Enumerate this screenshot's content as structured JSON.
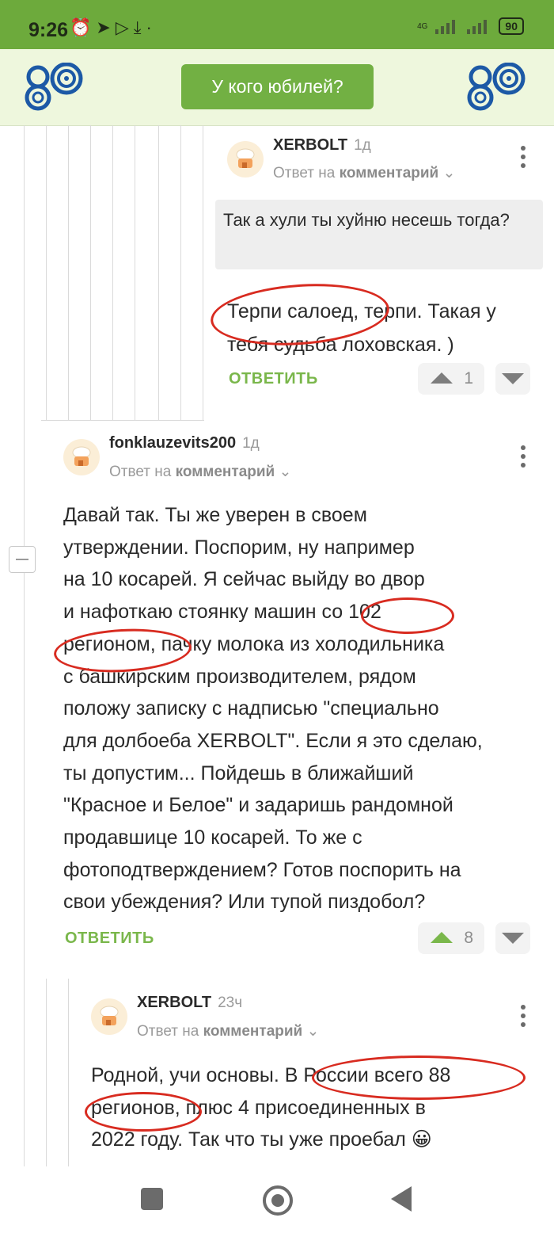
{
  "status_bar": {
    "time": "9:26",
    "battery": "90",
    "network": "4G"
  },
  "header": {
    "anniversary_button": "У кого юбилей?"
  },
  "comments": [
    {
      "username": "XERBOLT",
      "time": "1д",
      "reply_prefix": "Ответ на",
      "reply_target": "комментарий",
      "quote": "Так а хули ты хуйню несешь тогда?",
      "lines": [
        "Терпи салоед, терпи. Такая у",
        "тебя судьба лоховская. )"
      ],
      "reply_label": "ОТВЕТИТЬ",
      "votes": "1"
    },
    {
      "username": "fonklauzevits200",
      "time": "1д",
      "reply_prefix": "Ответ на",
      "reply_target": "комментарий",
      "lines": [
        "Давай так. Ты же уверен в своем",
        "утверждении. Поспорим, ну например",
        "на 10 косарей. Я сейчас выйду во двор",
        "и нафоткаю стоянку машин со 102",
        "регионом, пачку молока из холодильника",
        "с башкирским производителем, рядом",
        "положу записку с надписью \"специально",
        "для долбоеба XERBOLT\". Если я это сделаю,",
        "ты допустим... Пойдешь в ближайший",
        "\"Красное и Белое\" и задаришь рандомной",
        "продавшице 10 косарей. То же с",
        "фотоподтверждением? Готов поспорить на",
        "свои убеждения? Или тупой пиздобол?"
      ],
      "reply_label": "ОТВЕТИТЬ",
      "votes": "8"
    },
    {
      "username": "XERBOLT",
      "time": "23ч",
      "reply_prefix": "Ответ на",
      "reply_target": "комментарий",
      "lines": [
        "Родной, учи основы. В России всего 88",
        "регионов, плюс 4 присоединенных в",
        "2022 году. Так что ты уже проебал 😀"
      ]
    }
  ],
  "colors": {
    "accent": "#72b043",
    "status_bar": "#6daa3c",
    "header_bg": "#eef7dd",
    "annotation": "#d82b20"
  }
}
